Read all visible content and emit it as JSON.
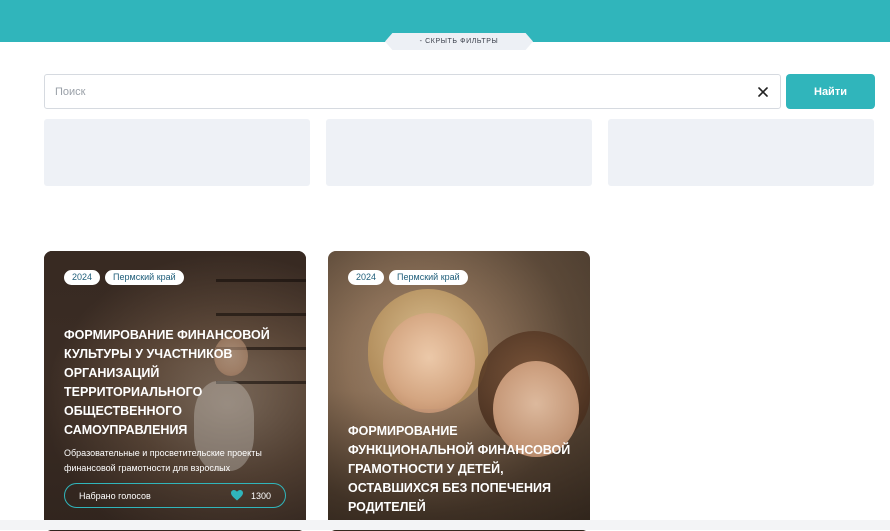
{
  "filters": {
    "toggle_label": "- СКРЫТЬ ФИЛЬТРЫ"
  },
  "search": {
    "placeholder": "Поиск",
    "value": "",
    "button_label": "Найти"
  },
  "colors": {
    "accent": "#30b5bb",
    "placeholder_bg": "#eef1f6"
  },
  "cards": [
    {
      "year": "2024",
      "region": "Пермский край",
      "title": "ФОРМИРОВАНИЕ ФИНАНСОВОЙ КУЛЬТУРЫ У УЧАСТНИКОВ ОРГАНИЗАЦИЙ ТЕРРИТОРИАЛЬНОГО ОБЩЕСТВЕННОГО САМОУПРАВЛЕНИЯ",
      "description": "Образовательные и просветительские проекты финансовой грамотности для взрослых",
      "votes_label": "Набрано голосов",
      "votes_count": "1300"
    },
    {
      "year": "2024",
      "region": "Пермский край",
      "title": "ФОРМИРОВАНИЕ ФУНКЦИОНАЛЬНОЙ ФИНАНСОВОЙ ГРАМОТНОСТИ У ДЕТЕЙ, ОСТАВШИХСЯ БЕЗ ПОПЕЧЕНИЯ РОДИТЕЛЕЙ"
    }
  ]
}
